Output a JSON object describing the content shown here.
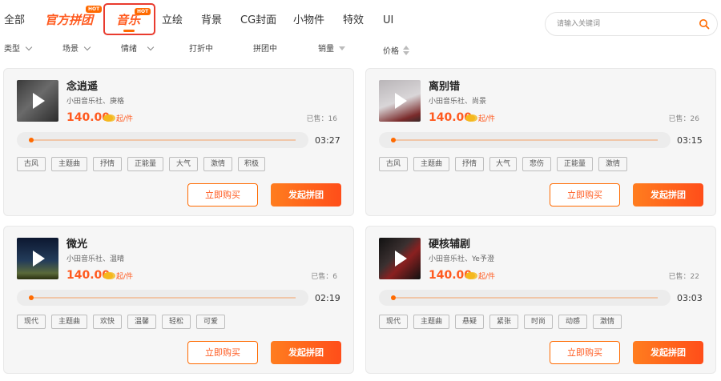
{
  "nav": {
    "all": "全部",
    "official_group": "官方拼团",
    "music": "音乐",
    "hot_badge": "HOT",
    "items": [
      "立绘",
      "背景",
      "CG封面",
      "小物件",
      "特效",
      "UI"
    ]
  },
  "search": {
    "placeholder": "请输入关键词",
    "value": ""
  },
  "filters": {
    "type": "类型",
    "scene": "场景",
    "mood": "情绪",
    "discounting": "打折中",
    "grouping": "拼团中",
    "sales": "销量",
    "price": "价格"
  },
  "colors": {
    "accent": "#ff5a1f",
    "highlight_border": "#e93b2f"
  },
  "cards": [
    {
      "title": "念逍遥",
      "artist": "小田音乐社、庚格",
      "price": "140.00",
      "unit": "起/件",
      "sold": "已售：16",
      "duration": "03:27",
      "tags": [
        "古风",
        "主题曲",
        "抒情",
        "正能量",
        "大气",
        "激情",
        "积极"
      ],
      "buy_label": "立即购买",
      "group_label": "发起拼团"
    },
    {
      "title": "离别错",
      "artist": "小田音乐社、尚景",
      "price": "140.00",
      "unit": "起/件",
      "sold": "已售：26",
      "duration": "03:15",
      "tags": [
        "古风",
        "主题曲",
        "抒情",
        "大气",
        "悲伤",
        "正能量",
        "激情"
      ],
      "buy_label": "立即购买",
      "group_label": "发起拼团"
    },
    {
      "title": "微光",
      "artist": "小田音乐社、温晴",
      "price": "140.00",
      "unit": "起/件",
      "sold": "已售：6",
      "duration": "02:19",
      "tags": [
        "现代",
        "主题曲",
        "欢快",
        "温馨",
        "轻松",
        "可爱"
      ],
      "buy_label": "立即购买",
      "group_label": "发起拼团"
    },
    {
      "title": "硬核辅剧",
      "artist": "小田音乐社、Ye予澄",
      "price": "140.00",
      "unit": "起/件",
      "sold": "已售：22",
      "duration": "03:03",
      "tags": [
        "现代",
        "主题曲",
        "悬疑",
        "紧张",
        "时尚",
        "动感",
        "激情"
      ],
      "buy_label": "立即购买",
      "group_label": "发起拼团"
    }
  ]
}
